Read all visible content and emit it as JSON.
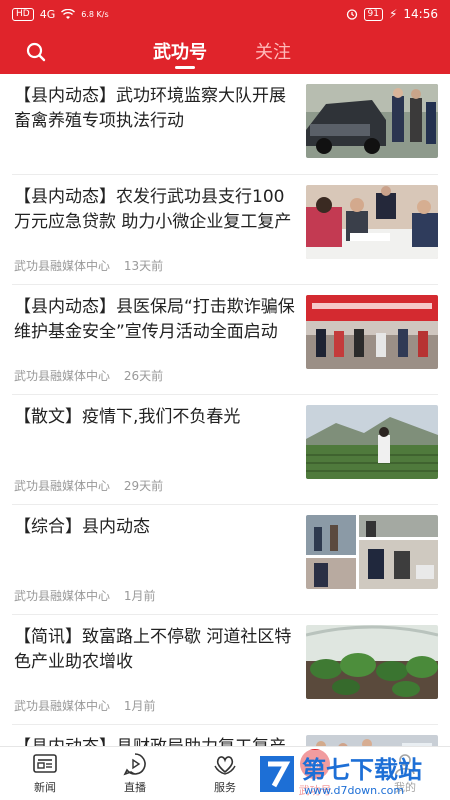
{
  "status_bar": {
    "network_chip": "HD",
    "signal": "4G",
    "speed": "6.8 K/s",
    "battery": "91",
    "time": "14:56"
  },
  "header": {
    "tabs": [
      {
        "label": "武功号",
        "active": true
      },
      {
        "label": "关注",
        "active": false
      }
    ]
  },
  "articles": [
    {
      "title": "【县内动态】武功环境监察大队开展畜禽养殖专项执法行动",
      "source": "",
      "time": "",
      "thumb": "cars-people"
    },
    {
      "title": "【县内动态】农发行武功县支行100万元应急贷款 助力小微企业复工复产",
      "source": "武功县融媒体中心",
      "time": "13天前",
      "thumb": "meeting"
    },
    {
      "title": "【县内动态】县医保局“打击欺诈骗保 维护基金安全”宣传月活动全面启动",
      "source": "武功县融媒体中心",
      "time": "26天前",
      "thumb": "banner-event"
    },
    {
      "title": "【散文】疫情下,我们不负春光",
      "source": "武功县融媒体中心",
      "time": "29天前",
      "thumb": "field-mountain"
    },
    {
      "title": "【综合】县内动态",
      "source": "武功县融媒体中心",
      "time": "1月前",
      "thumb": "collage"
    },
    {
      "title": "【简讯】致富路上不停歇 河道社区特色产业助农增收",
      "source": "武功县融媒体中心",
      "time": "1月前",
      "thumb": "plants"
    },
    {
      "title": "【县内动态】县财政局助力复工复产全力保障重点项目建设",
      "source": "",
      "time": "",
      "thumb": "construction"
    }
  ],
  "bottom_nav": [
    {
      "label": "新闻",
      "icon": "news-icon",
      "active": false
    },
    {
      "label": "直播",
      "icon": "live-icon",
      "active": false
    },
    {
      "label": "服务",
      "icon": "service-icon",
      "active": false
    },
    {
      "label": "武功号",
      "icon": "wugong-icon",
      "active": true
    },
    {
      "label": "我的",
      "icon": "user-icon",
      "active": false
    }
  ],
  "watermark": {
    "text": "第七下载站",
    "url": "www.d7down.com"
  },
  "colors": {
    "brand": "#e0242b",
    "text": "#222222",
    "meta": "#999999"
  }
}
